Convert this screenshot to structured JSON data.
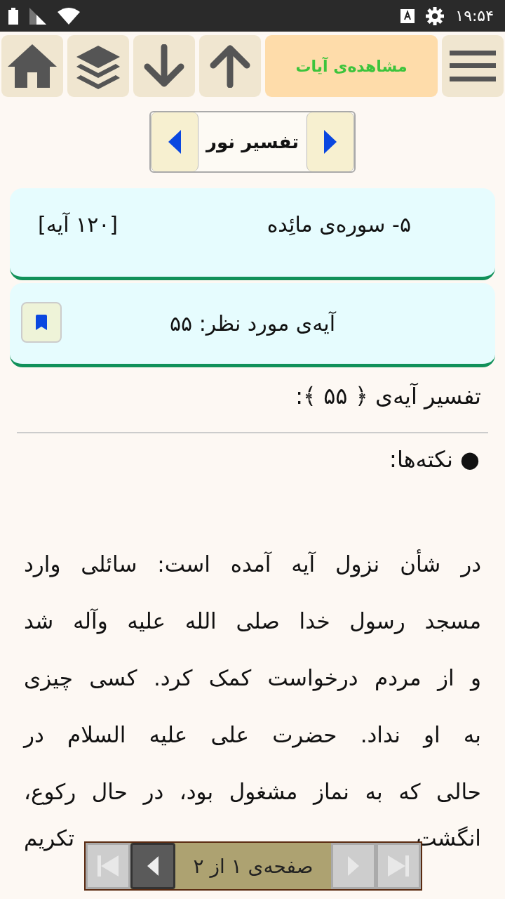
{
  "status_bar": {
    "time": "۱۹:۵۴"
  },
  "toolbar": [
    {
      "kind": "home"
    },
    {
      "kind": "layers"
    },
    {
      "kind": "down"
    },
    {
      "kind": "up"
    },
    {
      "kind": "text",
      "label": "مشاهده‌ی آیات"
    },
    {
      "kind": "menu"
    }
  ],
  "tafsir_selector": {
    "label": "تفسیر نور"
  },
  "surah_card": {
    "title": "۵- سوره‌ی مائِده",
    "count": "[۱۲۰ آیه]"
  },
  "ayah_card": {
    "title": "آیه‌ی مورد نظر: ۵۵"
  },
  "heading": "تفسیر آیه‌ی ﴿ ۵۵ ﴾:",
  "bullet": "● نکته‌ها:",
  "paragraph_lines": [
    "در شأن نزول آیه آمده است: سائلی وارد",
    "مسجد رسول خدا صلی الله علیه وآله شد",
    "و از مردم درخواست کمک کرد. کسی چیزی",
    "به او نداد. حضرت علی علیه السلام در",
    "حالی که به نماز مشغول بود، در حال رکوع،"
  ],
  "partial_line": {
    "right": "انگشت",
    "left": "تکریم"
  },
  "pager": {
    "label": "صفحه‌ی ۱ از ۲",
    "buttons": [
      {
        "kind": "end-left",
        "disabled": true
      },
      {
        "kind": "left",
        "disabled": false
      },
      {
        "kind": "right",
        "disabled": true
      },
      {
        "kind": "end-right",
        "disabled": true
      }
    ]
  }
}
